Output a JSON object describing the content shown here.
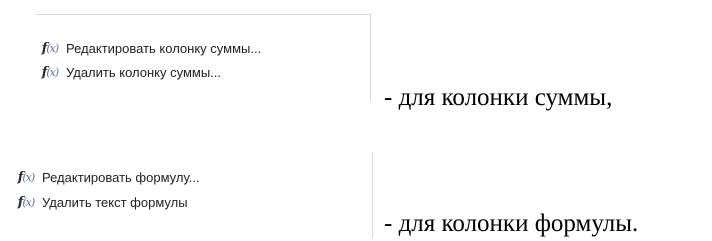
{
  "menu_sum": {
    "items": [
      {
        "icon": "fx-function-icon",
        "label": "Редактировать колонку суммы..."
      },
      {
        "icon": "fx-function-icon",
        "label": "Удалить колонку суммы..."
      }
    ]
  },
  "menu_formula": {
    "items": [
      {
        "icon": "fx-function-icon",
        "label": "Редактировать формулу..."
      },
      {
        "icon": "fx-function-icon",
        "label": "Удалить текст формулы"
      }
    ]
  },
  "captions": {
    "sum": "- для колонки суммы,",
    "formula": "- для колонки формулы."
  },
  "colors": {
    "menu_border": "#d9d9d9",
    "icon_accent": "#5b6fae",
    "text": "#222222"
  }
}
